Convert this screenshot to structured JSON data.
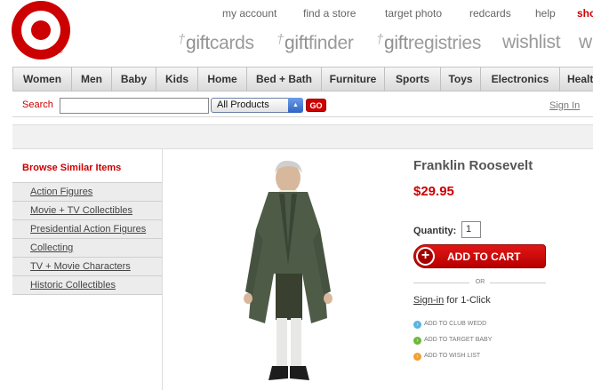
{
  "brand": {
    "logo_name": "target-bullseye",
    "accent": "#cc0000"
  },
  "utility_nav": {
    "my_account": "my account",
    "find_store": "find a store",
    "target_photo": "target photo",
    "redcards": "redcards",
    "help": "help",
    "shop_partial": "sho"
  },
  "service_nav": {
    "giftcards_prefix": "gift",
    "giftcards_suffix": "cards",
    "giftfinder_prefix": "gift",
    "giftfinder_suffix": "finder",
    "giftregistries_prefix": "gift",
    "giftregistries_suffix": "registries",
    "wishlist": "wishlist",
    "partial": "w"
  },
  "category_nav": {
    "women": "Women",
    "men": "Men",
    "baby": "Baby",
    "kids": "Kids",
    "home": "Home",
    "bed_bath": "Bed + Bath",
    "furniture": "Furniture",
    "sports": "Sports",
    "toys": "Toys",
    "electronics": "Electronics",
    "health_partial": "Health"
  },
  "search": {
    "label": "Search",
    "value": "",
    "category_selected": "All Products",
    "go_label": "GO",
    "signin_label": "Sign In",
    "separator": "|"
  },
  "sidebar": {
    "title": "Browse Similar Items",
    "items": [
      "Action Figures",
      "Movie + TV Collectibles",
      "Presidential Action Figures",
      "Collecting",
      "TV + Movie Characters",
      "Historic Collectibles"
    ]
  },
  "product": {
    "title": "Franklin Roosevelt",
    "price": "$29.95",
    "quantity_label": "Quantity:",
    "quantity_value": "1",
    "add_to_cart_label": "ADD TO CART",
    "or_label": "OR",
    "signin_link": "Sign-in",
    "signin_suffix": " for 1-Click",
    "add_links": {
      "club_wedd": "ADD TO CLUB WEDD",
      "target_baby": "ADD TO TARGET BABY",
      "wish_list": "ADD TO WISH LIST"
    },
    "link_colors": {
      "club_wedd": "#5ab4e0",
      "target_baby": "#6cb83a",
      "wish_list": "#f0a030"
    }
  }
}
